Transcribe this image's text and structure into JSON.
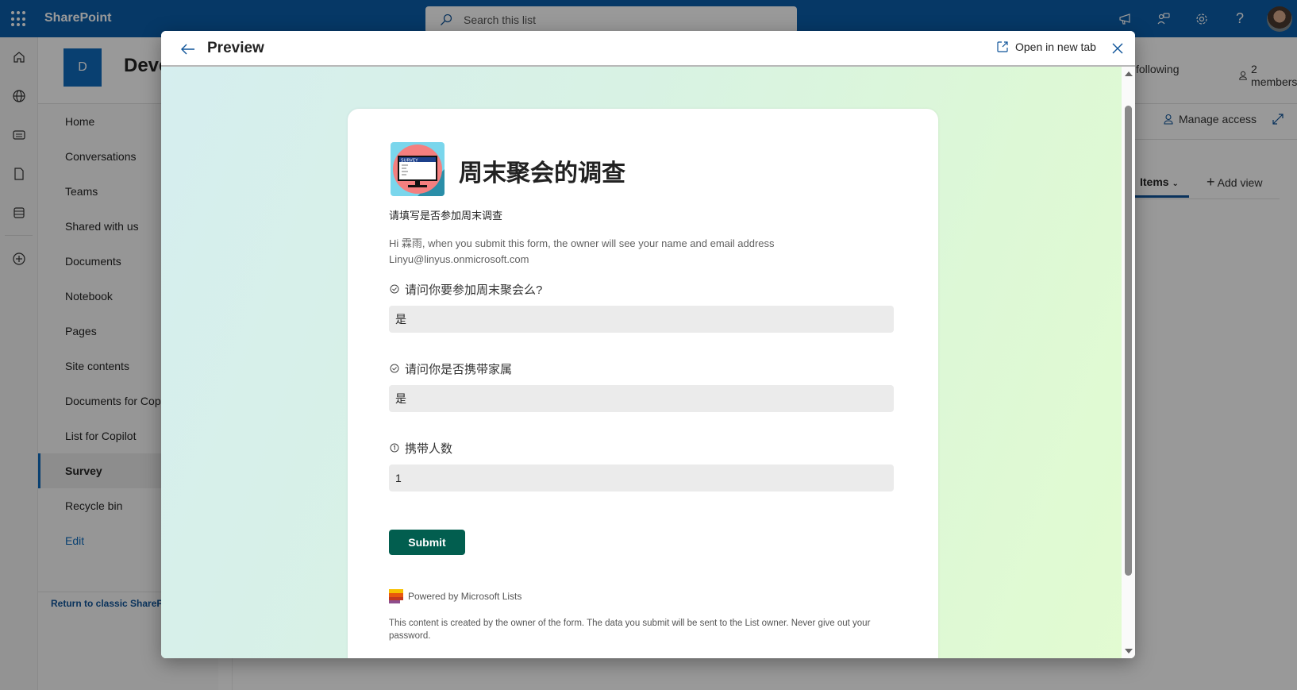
{
  "app": {
    "name": "SharePoint",
    "search_placeholder": "Search this list",
    "top_icons": [
      "megaphone-icon",
      "chat-people-icon",
      "settings-gear-icon",
      "help-question-icon"
    ]
  },
  "rail": {
    "icons": [
      "home-icon",
      "globe-icon",
      "news-icon",
      "file-icon",
      "list-icon",
      "add-circle-icon"
    ]
  },
  "site": {
    "logo_letter": "D",
    "title": "Deve",
    "following": "following",
    "members": "2 members",
    "manage_access": "Manage access"
  },
  "nav": {
    "items": [
      {
        "label": "Home"
      },
      {
        "label": "Conversations"
      },
      {
        "label": "Teams"
      },
      {
        "label": "Shared with us"
      },
      {
        "label": "Documents"
      },
      {
        "label": "Notebook"
      },
      {
        "label": "Pages"
      },
      {
        "label": "Site contents"
      },
      {
        "label": "Documents for Cop"
      },
      {
        "label": "List for Copilot"
      },
      {
        "label": "Survey",
        "active": true
      },
      {
        "label": "Recycle bin"
      },
      {
        "label": "Edit"
      }
    ],
    "return_classic": "Return to classic SharePoi"
  },
  "views": {
    "current": "Items",
    "add_view": "Add view"
  },
  "dialog": {
    "title": "Preview",
    "open_new_tab": "Open in new tab"
  },
  "form": {
    "title": "周末聚会的调查",
    "description": "请填写是否参加周末调查",
    "notice_line1": "Hi 霖雨, when you submit this form, the owner will see your name and email address",
    "notice_line2": "Linyu@linyus.onmicrosoft.com",
    "questions": [
      {
        "icon": "choice-check-icon",
        "label": "请问你要参加周末聚会么?",
        "value": "是"
      },
      {
        "icon": "choice-check-icon",
        "label": "请问你是否携带家属",
        "value": "是"
      },
      {
        "icon": "number-icon",
        "label": "携带人数",
        "value": "1"
      }
    ],
    "submit_label": "Submit",
    "powered_by": "Powered by Microsoft Lists",
    "disclaimer": "This content is created by the owner of the form. The data you submit will be sent to the List owner. Never give out your password."
  },
  "colors": {
    "suite_bar": "#0a5eab",
    "submit": "#025e4f",
    "input_bg": "#ebebeb"
  }
}
